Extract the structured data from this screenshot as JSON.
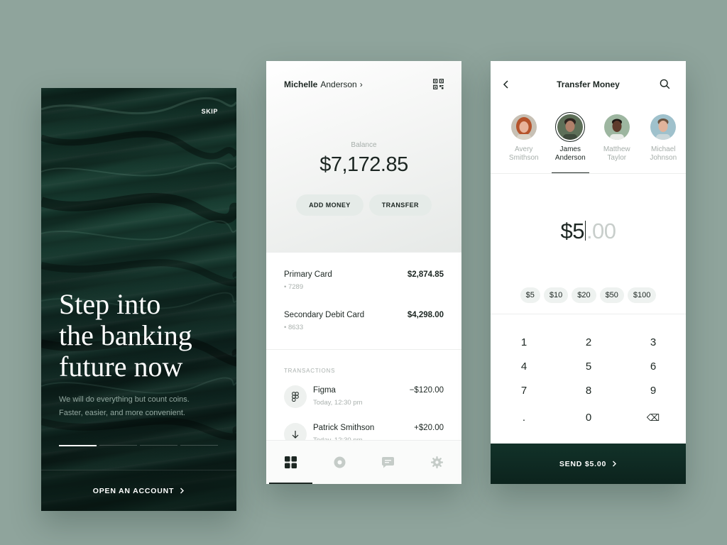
{
  "onboarding": {
    "skip_label": "SKIP",
    "headline": [
      "Step into",
      "the banking",
      "future now"
    ],
    "subtitle": [
      "We will do everything but count coins.",
      "Faster, easier, and more convenient."
    ],
    "progress_steps": 4,
    "active_step": 1,
    "cta_label": "OPEN AN ACCOUNT",
    "cta_icon": "chevron-right-icon"
  },
  "home": {
    "user_first": "Michelle",
    "user_last": "Anderson",
    "user_chevron": "›",
    "qr_icon": "qr-code-icon",
    "balance_label": "Balance",
    "balance_value": "$7,172.85",
    "add_money_label": "ADD MONEY",
    "transfer_label": "TRANSFER",
    "cards": [
      {
        "name": "Primary Card",
        "number": "• 7289",
        "amount": "$2,874.85"
      },
      {
        "name": "Secondary Debit Card",
        "number": "• 8633",
        "amount": "$4,298.00"
      }
    ],
    "transactions_title": "TRANSACTIONS",
    "transactions": [
      {
        "title": "Figma",
        "time": "Today, 12:30 pm",
        "amount": "−$120.00",
        "icon": "figma-icon"
      },
      {
        "title": "Patrick Smithson",
        "time": "Today, 12:30 pm",
        "amount": "+$20.00",
        "icon": "arrow-down-icon"
      }
    ],
    "tabs": [
      "dashboard-icon",
      "disc-icon",
      "chat-icon",
      "gear-icon"
    ],
    "active_tab": 0
  },
  "transfer": {
    "title": "Transfer Money",
    "back_icon": "chevron-left-icon",
    "search_icon": "search-icon",
    "contacts": [
      {
        "first": "Avery",
        "last": "Smithson",
        "selected": false,
        "skin": "#e8b39a",
        "hair": "#b5532b",
        "bg": "#c7c0b4"
      },
      {
        "first": "James",
        "last": "Anderson",
        "selected": true,
        "skin": "#b0806a",
        "hair": "#2d241f",
        "bg": "#5d6f58"
      },
      {
        "first": "Matthew",
        "last": "Taylor",
        "selected": false,
        "skin": "#5e3b2c",
        "hair": "#1d1713",
        "bg": "#9db6a0"
      },
      {
        "first": "Michael",
        "last": "Johnson",
        "selected": false,
        "skin": "#e0b39b",
        "hair": "#6b5340",
        "bg": "#9fc1cc"
      }
    ],
    "amount_whole": "$5",
    "amount_cents": ".00",
    "quick_amounts": [
      "$5",
      "$10",
      "$20",
      "$50",
      "$100"
    ],
    "keys": [
      "1",
      "2",
      "3",
      "4",
      "5",
      "6",
      "7",
      "8",
      "9",
      ".",
      "0",
      "⌫"
    ],
    "send_label": "SEND $5.00",
    "send_icon": "chevron-right-icon"
  }
}
